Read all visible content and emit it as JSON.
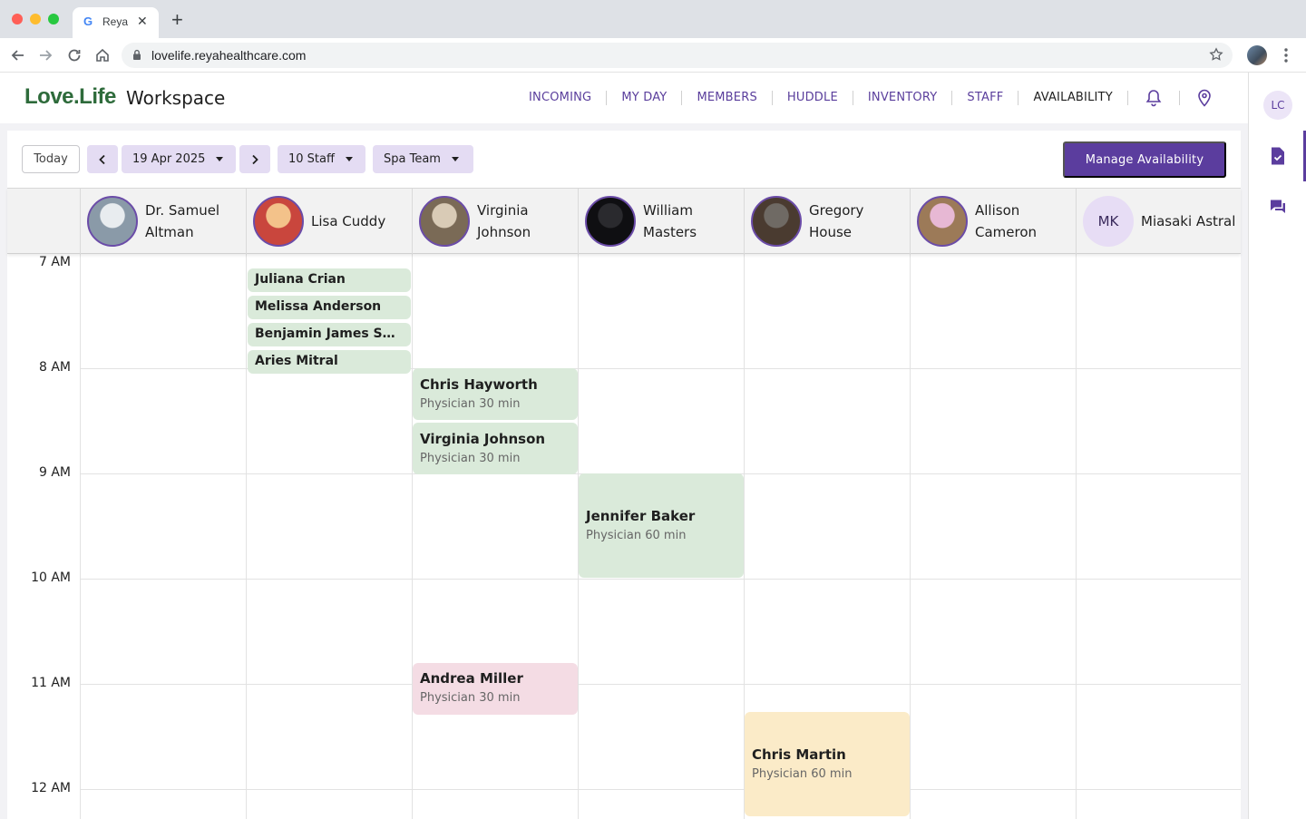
{
  "browser": {
    "tab_title": "Reya",
    "tab_favicon": "G",
    "url": "lovelife.reyahealthcare.com",
    "traffic_colors": [
      "#ff5f57",
      "#febc2e",
      "#28c840"
    ]
  },
  "app": {
    "logo": "Love.Life",
    "workspace_label": "Workspace",
    "nav": [
      {
        "label": "INCOMING",
        "active": false
      },
      {
        "label": "MY DAY",
        "active": false
      },
      {
        "label": "MEMBERS",
        "active": false
      },
      {
        "label": "HUDDLE",
        "active": false
      },
      {
        "label": "INVENTORY",
        "active": false
      },
      {
        "label": "STAFF",
        "active": false
      },
      {
        "label": "AVAILABILITY",
        "active": true
      }
    ],
    "accent": "#5b3d9e",
    "brand": "#2e6b3b"
  },
  "controls": {
    "today_label": "Today",
    "date_label": "19 Apr 2025",
    "staff_filter_label": "10 Staff",
    "team_filter_label": "Spa Team",
    "manage_label": "Manage Availability"
  },
  "staff": [
    {
      "name": "Dr. Samuel Altman",
      "avatar_kind": "photo",
      "avatar_colors": [
        "#e8ecef",
        "#8a9aa8"
      ]
    },
    {
      "name": "Lisa Cuddy",
      "avatar_kind": "photo",
      "avatar_colors": [
        "#f3c28a",
        "#c9463d"
      ]
    },
    {
      "name": "Virginia Johnson",
      "avatar_kind": "photo",
      "avatar_colors": [
        "#d9cbb6",
        "#7a6a56"
      ]
    },
    {
      "name": "William Masters",
      "avatar_kind": "photo",
      "avatar_colors": [
        "#2a2a2e",
        "#0f0f12"
      ]
    },
    {
      "name": "Gregory House",
      "avatar_kind": "photo",
      "avatar_colors": [
        "#6f6a64",
        "#4a3b30"
      ]
    },
    {
      "name": "Allison Cameron",
      "avatar_kind": "photo",
      "avatar_colors": [
        "#e7b8d4",
        "#9c7a58"
      ]
    },
    {
      "name": "Miasaki Astral",
      "avatar_kind": "initials",
      "initials": "MK"
    }
  ],
  "time_labels": [
    "7 AM",
    "8 AM",
    "9 AM",
    "10 AM",
    "11 AM",
    "12 AM"
  ],
  "pills": [
    {
      "staff_index": 1,
      "start_hour": 7.05,
      "label": "Juliana Crian"
    },
    {
      "staff_index": 1,
      "start_hour": 7.31,
      "label": "Melissa Anderson"
    },
    {
      "staff_index": 1,
      "start_hour": 7.57,
      "label": "Benjamin James Sa..."
    },
    {
      "staff_index": 1,
      "start_hour": 7.83,
      "label": "Aries Mitral"
    }
  ],
  "appointments": [
    {
      "staff_index": 2,
      "start_hour": 8.0,
      "duration_hours": 0.5,
      "name": "Chris Hayworth",
      "detail": "Physician 30 min",
      "color": "#daeada"
    },
    {
      "staff_index": 2,
      "start_hour": 8.52,
      "duration_hours": 0.5,
      "name": "Virginia Johnson",
      "detail": "Physician 30 min",
      "color": "#daeada"
    },
    {
      "staff_index": 3,
      "start_hour": 9.0,
      "duration_hours": 1.0,
      "name": "Jennifer Baker",
      "detail": "Physician 60 min",
      "color": "#daeada"
    },
    {
      "staff_index": 2,
      "start_hour": 10.8,
      "duration_hours": 0.5,
      "name": "Andrea Miller",
      "detail": "Physician 30 min",
      "color": "#f4dce4"
    },
    {
      "staff_index": 4,
      "start_hour": 11.27,
      "duration_hours": 1.0,
      "name": "Chris Martin",
      "detail": "Physician 60 min",
      "color": "#fbebc8"
    }
  ],
  "rail": {
    "user_initials": "LC"
  }
}
